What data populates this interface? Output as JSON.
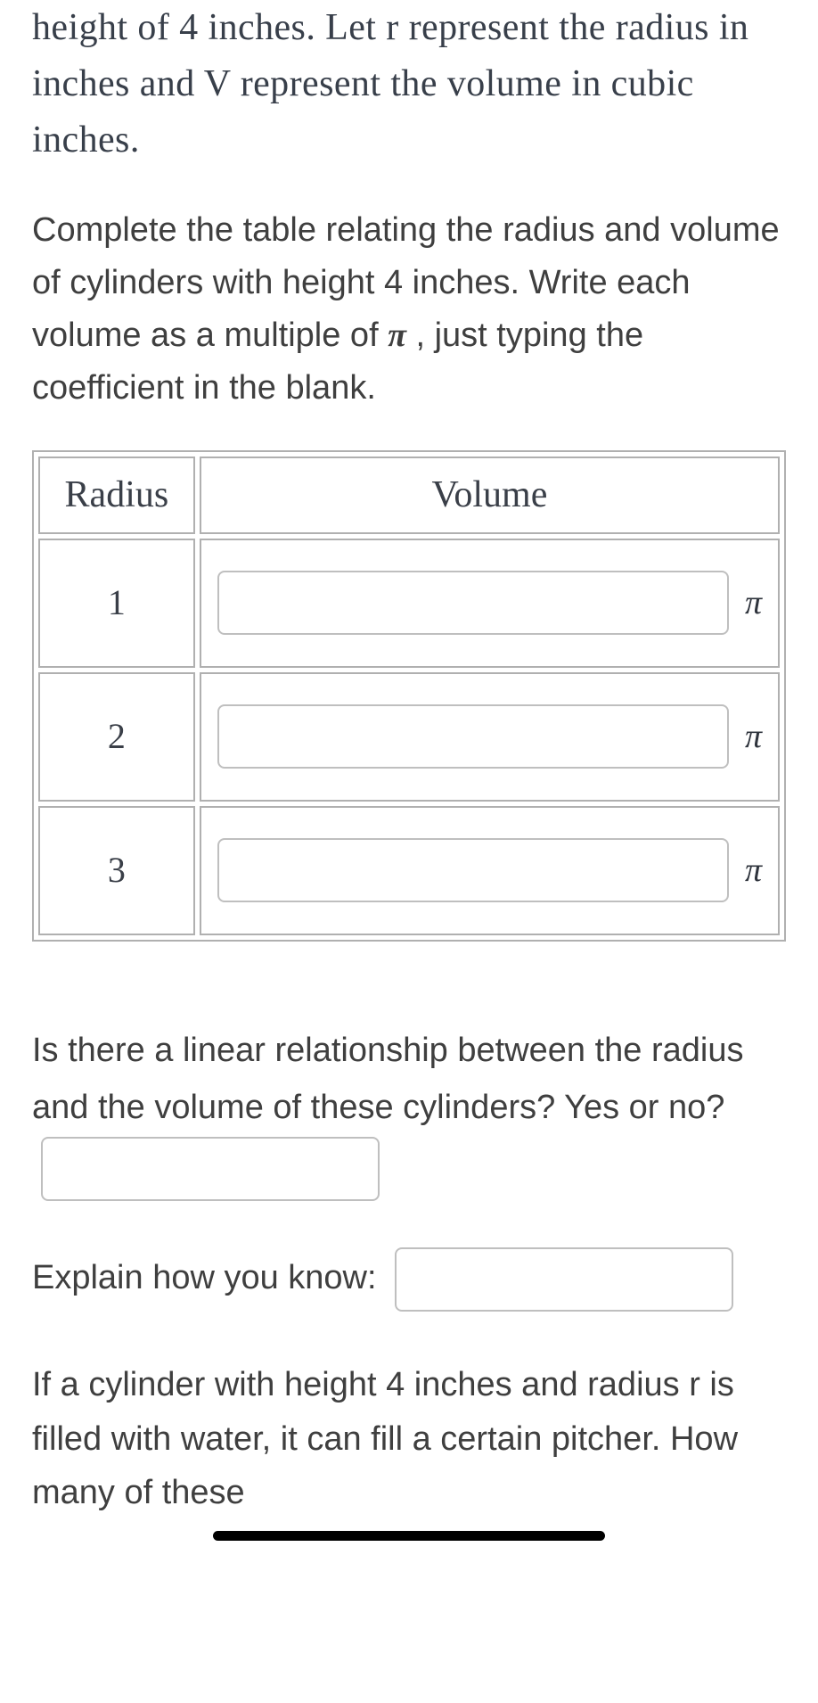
{
  "intro": "height of 4 inches. Let r represent the radius in inches and V represent the volume in cubic inches.",
  "instructions_pre_pi": "Complete the table relating the radius and volume of cylinders with height 4 inches. Write each volume as a multiple of ",
  "instructions_post_pi": " , just typing the coefficient in the blank.",
  "pi": "π",
  "table": {
    "header_radius": "Radius",
    "header_volume": "Volume",
    "rows": [
      {
        "radius": "1",
        "volume_coeff": ""
      },
      {
        "radius": "2",
        "volume_coeff": ""
      },
      {
        "radius": "3",
        "volume_coeff": ""
      }
    ]
  },
  "q_linear_pre": "Is there a linear relationship between the radius and the volume of these cylinders? Yes or no? ",
  "q_linear_value": "",
  "q_explain_pre": "Explain how you know: ",
  "q_explain_value": "",
  "final": "If a cylinder with height 4 inches and radius r is filled with water, it can fill a certain pitcher. How many of these"
}
